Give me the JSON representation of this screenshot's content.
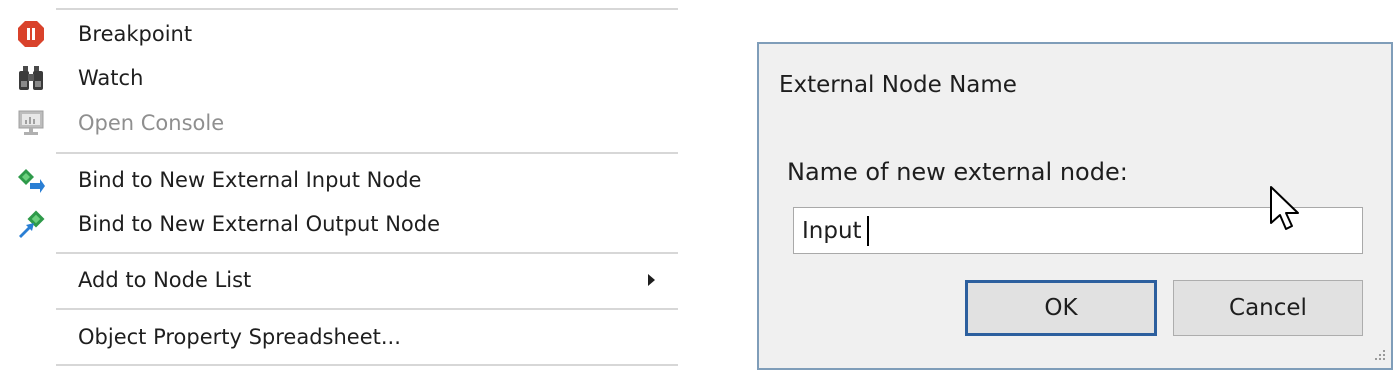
{
  "context_menu": {
    "items": [
      {
        "label": "Breakpoint",
        "icon": "stop-sign-icon",
        "enabled": true
      },
      {
        "label": "Watch",
        "icon": "binoculars-icon",
        "enabled": true
      },
      {
        "label": "Open Console",
        "icon": "monitor-console-icon",
        "enabled": false
      },
      {
        "label": "Bind to New External Input Node",
        "icon": "bind-input-icon",
        "enabled": true
      },
      {
        "label": "Bind to New External Output Node",
        "icon": "bind-output-icon",
        "enabled": true
      },
      {
        "label": "Add to Node List",
        "has_submenu": true,
        "enabled": true
      },
      {
        "label": "Object Property Spreadsheet...",
        "enabled": true
      }
    ]
  },
  "dialog": {
    "title": "External Node Name",
    "prompt": "Name of new external node:",
    "input_value": "Input",
    "ok_label": "OK",
    "cancel_label": "Cancel"
  },
  "colors": {
    "dialog_border": "#7f9db9",
    "dialog_background": "#f0f0f0",
    "ok_button_border": "#2c5f9e",
    "disabled_text": "#8f8f8f",
    "breakpoint_red": "#d9422b"
  }
}
